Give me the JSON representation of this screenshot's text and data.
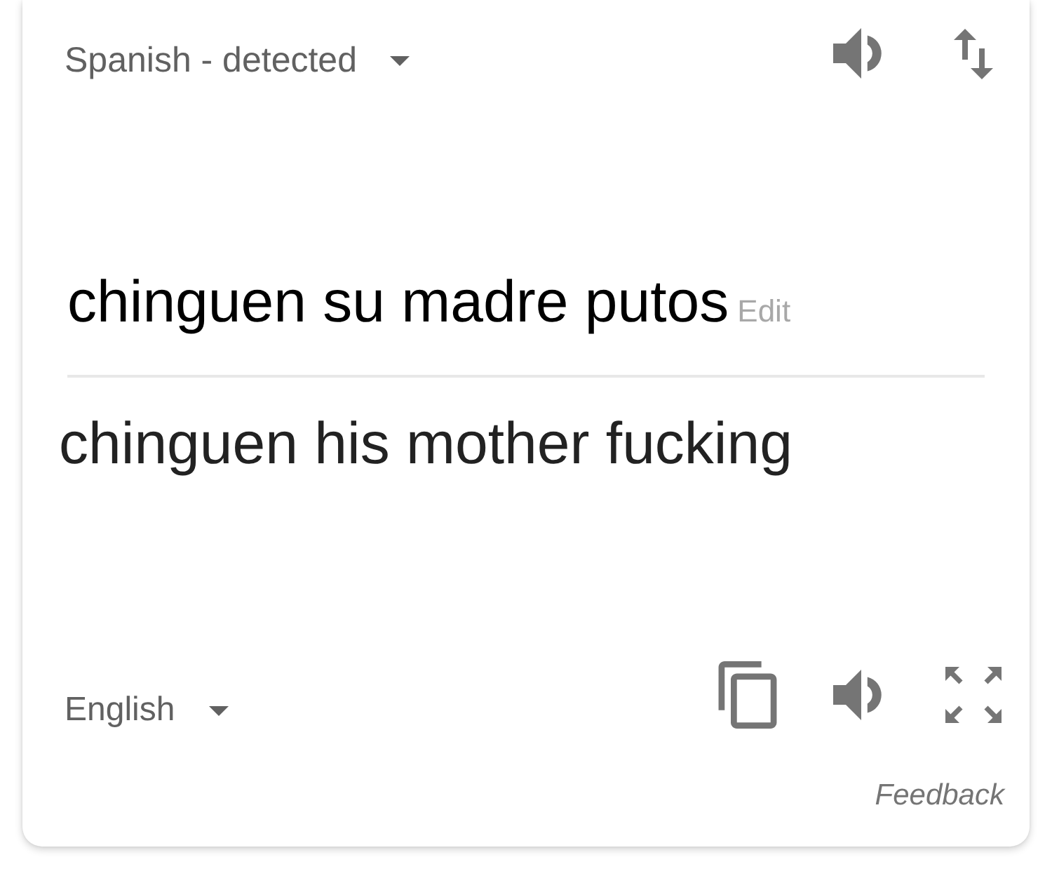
{
  "source": {
    "language": "Spanish - detected",
    "text": "chinguen su madre putos",
    "edit_link": "Edit"
  },
  "translation": {
    "text": "chinguen his mother fucking",
    "language": "English"
  },
  "feedback_link": "Feedback"
}
